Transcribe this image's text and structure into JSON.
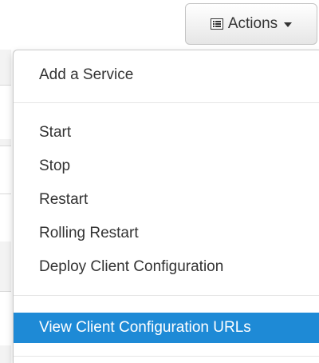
{
  "toolbar": {
    "actions_label": "Actions",
    "actions_icon": "list-icon"
  },
  "menu": {
    "items": [
      {
        "label": "Add a Service"
      },
      {
        "label": "Start"
      },
      {
        "label": "Stop"
      },
      {
        "label": "Restart"
      },
      {
        "label": "Rolling Restart"
      },
      {
        "label": "Deploy Client Configuration"
      },
      {
        "label": "View Client Configuration URLs",
        "highlighted": true
      }
    ]
  },
  "colors": {
    "highlight": "#1e8ad6",
    "text": "#333333"
  }
}
